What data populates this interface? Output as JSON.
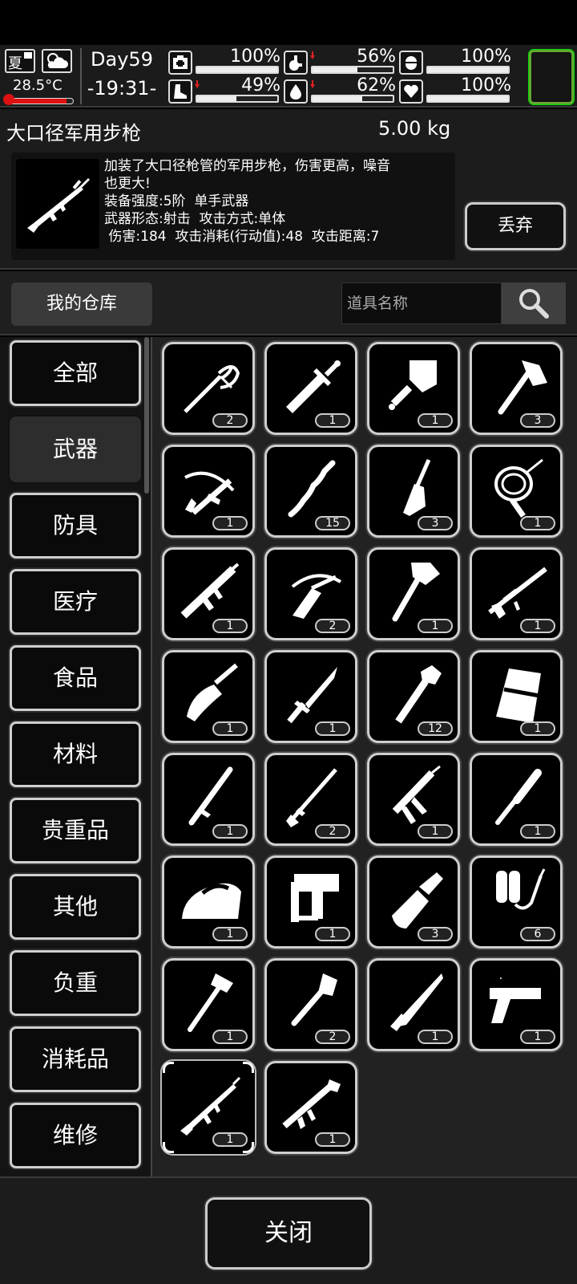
{
  "status": {
    "season": "夏",
    "weather_icon": "partly-cloudy-icon",
    "temperature": "28.5°C",
    "temperature_level": 0.9,
    "day": "Day59",
    "time": "-19:31-",
    "stats": [
      {
        "name": "health",
        "icon": "medkit-icon",
        "value": "100%",
        "level": 1.0,
        "declining": false
      },
      {
        "name": "hunger",
        "icon": "stomach-icon",
        "value": "56%",
        "level": 0.56,
        "declining": true
      },
      {
        "name": "medicine",
        "icon": "pill-icon",
        "value": "100%",
        "level": 1.0,
        "declining": false
      },
      {
        "name": "stamina",
        "icon": "boot-icon",
        "value": "49%",
        "level": 0.49,
        "declining": true
      },
      {
        "name": "thirst",
        "icon": "water-drop-icon",
        "value": "62%",
        "level": 0.62,
        "declining": true
      },
      {
        "name": "mood",
        "icon": "heart-icon",
        "value": "100%",
        "level": 1.0,
        "declining": false
      }
    ]
  },
  "selected_item": {
    "name": "大口径军用步枪",
    "weight": "5.00 kg",
    "description_lines": [
      "加装了大口径枪管的军用步枪，伤害更高，噪音",
      "也更大!",
      "装备强度:5阶  单手武器",
      "武器形态:射击  攻击方式:单体",
      " 伤害:184  攻击消耗(行动值):48  攻击距离:7"
    ],
    "discard_label": "丢弃"
  },
  "storage": {
    "title": "我的仓库",
    "search_placeholder": "道具名称"
  },
  "categories": [
    {
      "label": "全部",
      "active": false
    },
    {
      "label": "武器",
      "active": true
    },
    {
      "label": "防具",
      "active": false
    },
    {
      "label": "医疗",
      "active": false
    },
    {
      "label": "食品",
      "active": false
    },
    {
      "label": "材料",
      "active": false
    },
    {
      "label": "贵重品",
      "active": false
    },
    {
      "label": "其他",
      "active": false
    },
    {
      "label": "负重",
      "active": false
    },
    {
      "label": "消耗品",
      "active": false
    },
    {
      "label": "维修",
      "active": false
    }
  ],
  "items": [
    {
      "icon": "rapier-icon",
      "count": "2"
    },
    {
      "icon": "broadsword-icon",
      "count": "1"
    },
    {
      "icon": "cleaver-icon",
      "count": "1"
    },
    {
      "icon": "hatchet-icon",
      "count": "3"
    },
    {
      "icon": "crossbow-icon",
      "count": "1"
    },
    {
      "icon": "wooden-club-icon",
      "count": "15"
    },
    {
      "icon": "chisel-icon",
      "count": "3"
    },
    {
      "icon": "whip-icon",
      "count": "1"
    },
    {
      "icon": "assault-rifle-icon",
      "count": "1"
    },
    {
      "icon": "compound-crossbow-icon",
      "count": "2"
    },
    {
      "icon": "axe-icon",
      "count": "1"
    },
    {
      "icon": "sniper-rifle-icon",
      "count": "1"
    },
    {
      "icon": "folding-knife-icon",
      "count": "1"
    },
    {
      "icon": "dagger-icon",
      "count": "1"
    },
    {
      "icon": "pipe-wrench-icon",
      "count": "12"
    },
    {
      "icon": "riot-shield-icon",
      "count": "1"
    },
    {
      "icon": "baton-icon",
      "count": "1"
    },
    {
      "icon": "spear-icon",
      "count": "2"
    },
    {
      "icon": "caulking-gun-icon",
      "count": "1"
    },
    {
      "icon": "baseball-bat-icon",
      "count": "1"
    },
    {
      "icon": "clothes-iron-icon",
      "count": "1"
    },
    {
      "icon": "nail-gun-icon",
      "count": "1"
    },
    {
      "icon": "pipe-cutter-icon",
      "count": "3"
    },
    {
      "icon": "flamethrower-icon",
      "count": "6"
    },
    {
      "icon": "fire-axe-icon",
      "count": "1"
    },
    {
      "icon": "shovel-icon",
      "count": "2"
    },
    {
      "icon": "machete-icon",
      "count": "1"
    },
    {
      "icon": "desert-eagle-pistol-icon",
      "count": "1"
    },
    {
      "icon": "military-rifle-icon",
      "count": "1",
      "selected": true
    },
    {
      "icon": "rocket-launcher-icon",
      "count": "1"
    }
  ],
  "close_label": "关闭"
}
